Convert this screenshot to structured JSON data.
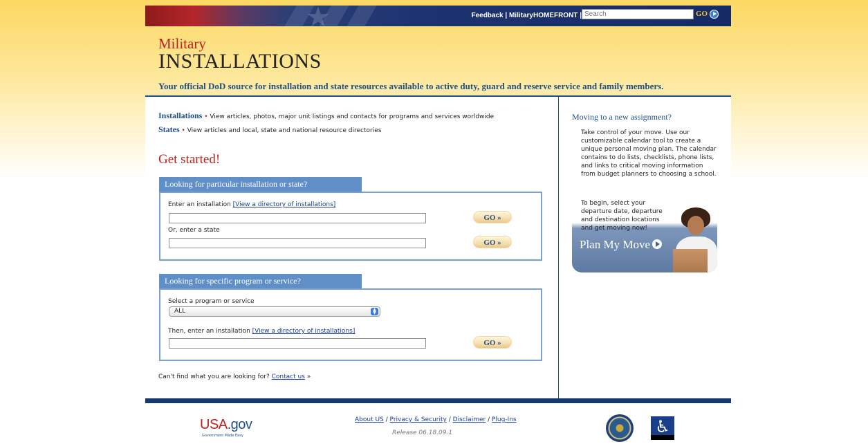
{
  "header": {
    "links": {
      "feedback": "Feedback",
      "sep": " | ",
      "homefront": "MilitaryHOMEFRONT",
      "sep_after": " |"
    },
    "search_placeholder": "Search",
    "search_go": "GO"
  },
  "brand": {
    "line1": "Military",
    "line2": "INSTALLATIONS",
    "tagline": "Your official DoD source for installation and state resources available to active duty, guard and reserve service and family members."
  },
  "intro": {
    "installations_key": "Installations",
    "installations_text": " View articles, photos, major unit listings and contacts for programs and services worldwide",
    "states_key": "States",
    "states_text": " View articles and local, state and national resource directories",
    "bullet": "•"
  },
  "get_started": "Get started!",
  "panel1": {
    "tab": "Looking for particular installation or state?",
    "installation_label": "Enter an installation ",
    "directory_link": "[View a directory of installations]",
    "state_label": "Or, enter a state",
    "go_label": "GO »"
  },
  "panel2": {
    "tab": "Looking for specific program or service?",
    "select_label": "Select a program or service",
    "select_value": "ALL",
    "installation_label": "Then, enter an installation ",
    "directory_link": "[View a directory of installations]",
    "go_label": "GO »"
  },
  "help": {
    "text": "Can't find what you are looking for? ",
    "link": "Contact us",
    "suffix": " »"
  },
  "sidebar": {
    "title": "Moving to a new assignment?",
    "text": "Take control of your move. Use our customizable calendar tool to create a unique personal moving plan. The calendar contains to do lists, checklists, phone lists, and links to critical moving information from budget planners to choosing a school.",
    "promo_text": "To begin, select your departure date, departure and destination locations and get moving now!",
    "promo_cta": "Plan My Move"
  },
  "footer": {
    "usa_a": "USA",
    "usa_b": ".gov",
    "usa_sub": "Government Made Easy",
    "links": [
      "About US",
      "Privacy & Security",
      "Disclaimer",
      "Plug-Ins"
    ],
    "sep": " / ",
    "release": "Release 06.18.09.1"
  },
  "colors": {
    "navy": "#1f4f86",
    "red": "#c11f1f",
    "tab_blue": "#5f8fc6",
    "gold_bg": "#fcd863"
  }
}
